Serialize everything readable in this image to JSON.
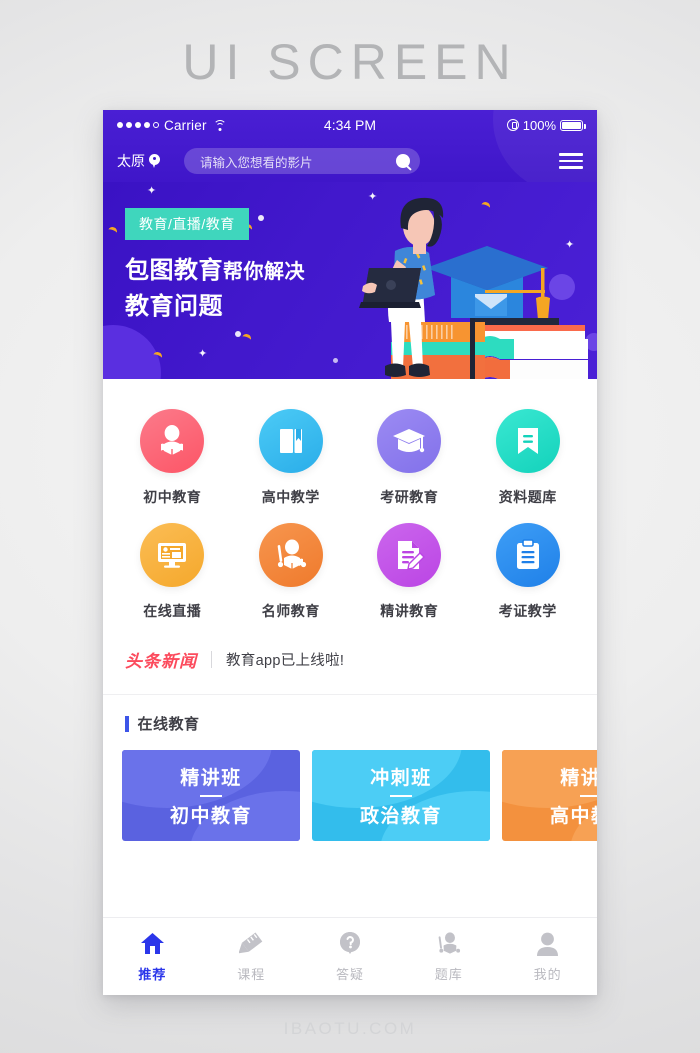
{
  "page": {
    "title": "UI SCREEN",
    "footer": "IBAOTU.COM"
  },
  "colors": {
    "header_purple": "#4119cc",
    "banner_purple": "#4218cc",
    "tag_green": "#3fd6bd",
    "accent_blue": "#2b36ea",
    "news_red": "#fc4b5d"
  },
  "status_bar": {
    "carrier": "Carrier",
    "time": "4:34 PM",
    "battery": "100%",
    "signal_dots": 5,
    "signal_filled": 4
  },
  "nav": {
    "location": "太原",
    "search_placeholder": "请输入您想看的影片",
    "search_value": ""
  },
  "banner": {
    "tag": "教育/直播/教育",
    "headline_strong": "包图教育",
    "headline_rest": "帮你解决",
    "headline_line2": "教育问题"
  },
  "grid": [
    {
      "label": "初中教育",
      "icon": "student-reading-icon",
      "color": "#fd6070",
      "color2": "#fb7b8b"
    },
    {
      "label": "高中教学",
      "icon": "book-bookmark-icon",
      "color": "#33b5ef",
      "color2": "#46c8f5"
    },
    {
      "label": "考研教育",
      "icon": "graduation-cap-icon",
      "color": "#8d7bee",
      "color2": "#9c8bf3"
    },
    {
      "label": "资料题库",
      "icon": "bookmark-lines-icon",
      "color": "#1fdcc4",
      "color2": "#3ae8d2"
    },
    {
      "label": "在线直播",
      "icon": "monitor-live-icon",
      "color": "#f7b141",
      "color2": "#fbbd55"
    },
    {
      "label": "名师教育",
      "icon": "teacher-pointer-icon",
      "color": "#f3853e",
      "color2": "#f7964f"
    },
    {
      "label": "精讲教育",
      "icon": "document-pencil-icon",
      "color": "#c355e8",
      "color2": "#cb66ed"
    },
    {
      "label": "考证教学",
      "icon": "clipboard-icon",
      "color": "#2f8fee",
      "color2": "#3e9ef6"
    }
  ],
  "news": {
    "badge": "头条新闻",
    "text": "教育app已上线啦!"
  },
  "section": {
    "title": "在线教育"
  },
  "cards": [
    {
      "title": "精讲班",
      "subtitle": "初中教育",
      "color": "#5a62e0",
      "color2": "#6a72ea"
    },
    {
      "title": "冲刺班",
      "subtitle": "政治教育",
      "color": "#33bdec",
      "color2": "#4ccdf5"
    },
    {
      "title": "精讲班",
      "subtitle": "高中教育",
      "color": "#f3913e",
      "color2": "#f7a154"
    }
  ],
  "tabbar": [
    {
      "label": "推荐",
      "icon": "home-icon",
      "active": true
    },
    {
      "label": "课程",
      "icon": "pencil-ruler-icon",
      "active": false
    },
    {
      "label": "答疑",
      "icon": "question-pin-icon",
      "active": false
    },
    {
      "label": "题库",
      "icon": "teacher-book-icon",
      "active": false
    },
    {
      "label": "我的",
      "icon": "user-icon",
      "active": false
    }
  ]
}
